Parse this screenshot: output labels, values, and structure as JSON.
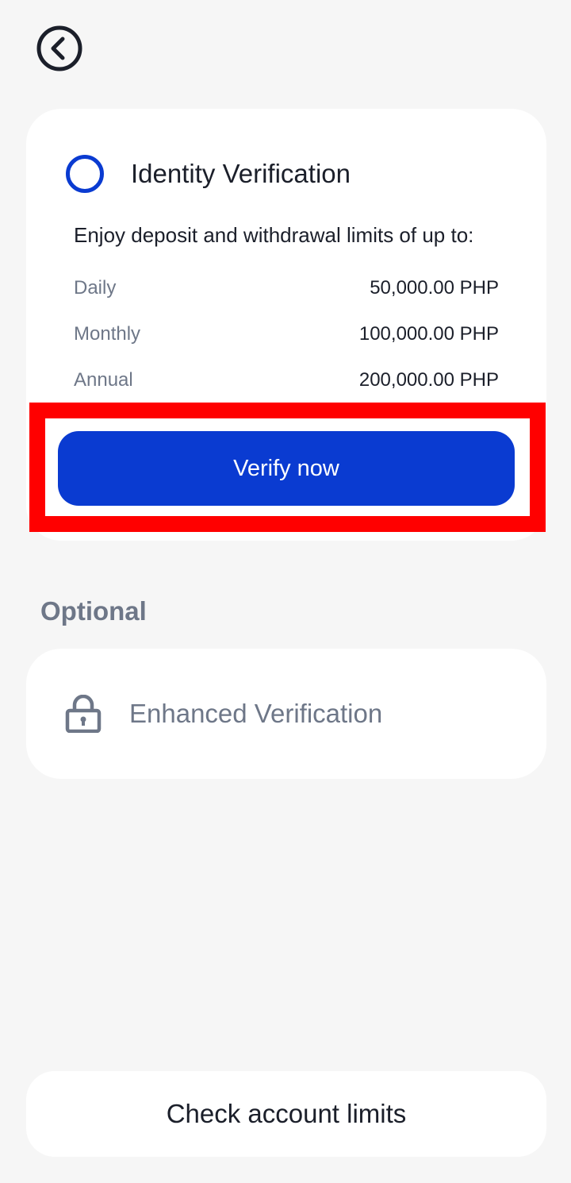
{
  "header": {
    "back_icon": "chevron-left-circle-icon"
  },
  "identity_card": {
    "step_icon": "empty-circle-icon",
    "title": "Identity Verification",
    "subtitle": "Enjoy deposit and withdrawal limits of up to:",
    "limits": [
      {
        "label": "Daily",
        "value": "50,000.00 PHP"
      },
      {
        "label": "Monthly",
        "value": "100,000.00 PHP"
      },
      {
        "label": "Annual",
        "value": "200,000.00 PHP"
      }
    ],
    "verify_label": "Verify now"
  },
  "optional_section": {
    "heading": "Optional",
    "enhanced_title": "Enhanced Verification",
    "enhanced_icon": "lock-icon"
  },
  "footer": {
    "check_limits_label": "Check account limits"
  },
  "colors": {
    "accent": "#0a3bd1",
    "highlight": "#ff0000",
    "muted_text": "#6e7788",
    "primary_text": "#1b1f2a",
    "background": "#f6f6f6"
  }
}
